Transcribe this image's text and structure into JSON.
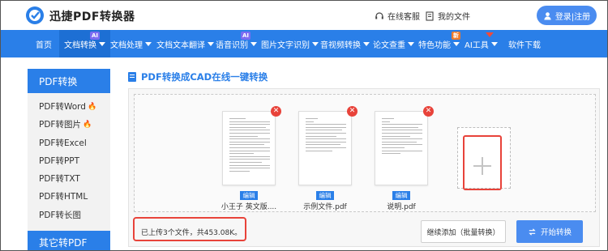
{
  "header": {
    "brand": "迅捷PDF转换器",
    "service_link": "在线客服",
    "docs_link": "我的文件",
    "login_label": "登录|注册"
  },
  "nav": {
    "items": [
      {
        "label": "首页"
      },
      {
        "label": "文档转换",
        "badge": "AI"
      },
      {
        "label": "文档处理"
      },
      {
        "label": "文档文本翻译"
      },
      {
        "label": "语音识别",
        "badge": "AI"
      },
      {
        "label": "图片文字识别"
      },
      {
        "label": "音视频转换"
      },
      {
        "label": "论文查重"
      },
      {
        "label": "特色功能",
        "badge": "新"
      },
      {
        "label": "AI工具"
      },
      {
        "label": "软件下载"
      }
    ]
  },
  "sidebar": {
    "title": "PDF转换",
    "items": [
      {
        "label": "PDF转Word",
        "hot": true
      },
      {
        "label": "PDF转图片",
        "hot": true
      },
      {
        "label": "PDF转Excel",
        "hot": false
      },
      {
        "label": "PDF转PPT",
        "hot": false
      },
      {
        "label": "PDF转TXT",
        "hot": false
      },
      {
        "label": "PDF转HTML",
        "hot": false
      },
      {
        "label": "PDF转长图",
        "hot": false
      }
    ],
    "section2_title": "其它转PDF"
  },
  "main": {
    "title": "PDF转换成CAD在线一键转换",
    "files": [
      {
        "name": "小王子 英文版....",
        "edit_label": "编辑"
      },
      {
        "name": "示例文件.pdf",
        "edit_label": "编辑"
      },
      {
        "name": "说明.pdf",
        "edit_label": "编辑"
      }
    ],
    "status": "已上传3个文件，共453.08K。",
    "continue_label": "继续添加（批量转换）",
    "start_label": "开始转换"
  },
  "colors": {
    "primary": "#2a7fe8",
    "nav_active": "#1d6fd4",
    "accent_red": "#e8433a",
    "button_blue": "#4a8cf0"
  }
}
